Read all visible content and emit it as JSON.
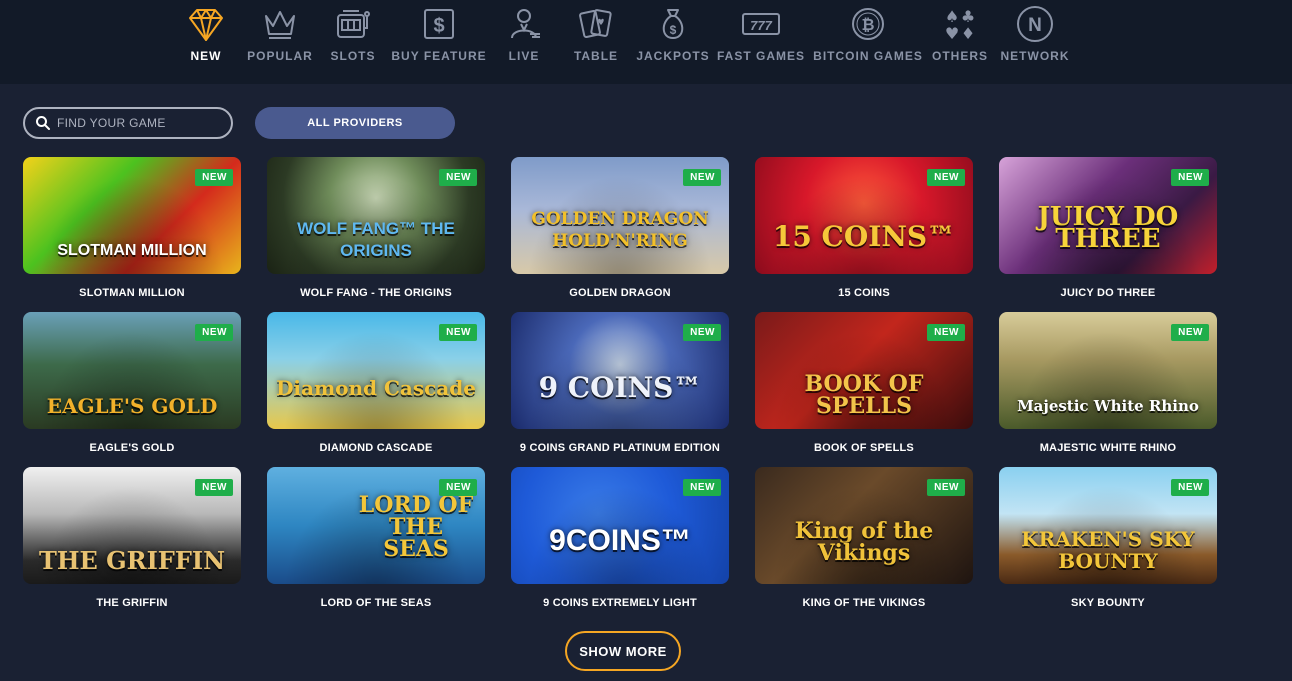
{
  "nav": {
    "items": [
      {
        "label": "NEW",
        "icon": "diamond-icon",
        "active": true
      },
      {
        "label": "POPULAR",
        "icon": "crown-icon",
        "active": false
      },
      {
        "label": "SLOTS",
        "icon": "slot-machine-icon",
        "active": false
      },
      {
        "label": "BUY FEATURE",
        "icon": "dollar-box-icon",
        "active": false
      },
      {
        "label": "LIVE",
        "icon": "live-dealer-icon",
        "active": false
      },
      {
        "label": "TABLE",
        "icon": "cards-icon",
        "active": false
      },
      {
        "label": "JACKPOTS",
        "icon": "money-bag-icon",
        "active": false
      },
      {
        "label": "FAST GAMES",
        "icon": "777-icon",
        "active": false
      },
      {
        "label": "BITCOIN GAMES",
        "icon": "bitcoin-icon",
        "active": false
      },
      {
        "label": "OTHERS",
        "icon": "card-suits-icon",
        "active": false
      },
      {
        "label": "NETWORK",
        "icon": "network-n-icon",
        "active": false
      }
    ]
  },
  "filters": {
    "search_placeholder": "FIND YOUR GAME",
    "search_value": "",
    "providers_label": "ALL PROVIDERS"
  },
  "badge_label": "NEW",
  "games": [
    {
      "title": "SLOTMAN MILLION",
      "logo": "SLOTMAN MILLION",
      "new": true
    },
    {
      "title": "WOLF FANG - THE ORIGINS",
      "logo": "WOLF FANG™ THE ORIGINS",
      "new": true
    },
    {
      "title": "GOLDEN DRAGON",
      "logo": "GOLDEN DRAGON HOLD'N'RING",
      "new": true
    },
    {
      "title": "15 COINS",
      "logo": "15 COINS™",
      "new": true
    },
    {
      "title": "JUICY DO THREE",
      "logo": "JUICY DO THREE",
      "new": true
    },
    {
      "title": "EAGLE'S GOLD",
      "logo": "EAGLE'S GOLD",
      "new": true
    },
    {
      "title": "DIAMOND CASCADE",
      "logo": "Diamond Cascade",
      "new": true
    },
    {
      "title": "9 COINS GRAND PLATINUM EDITION",
      "logo": "9 COINS™",
      "new": true
    },
    {
      "title": "BOOK OF SPELLS",
      "logo": "BOOK OF SPELLS",
      "new": true
    },
    {
      "title": "MAJESTIC WHITE RHINO",
      "logo": "Majestic White Rhino",
      "new": true
    },
    {
      "title": "THE GRIFFIN",
      "logo": "THE GRIFFIN",
      "new": true
    },
    {
      "title": "LORD OF THE SEAS",
      "logo": "LORD OF THE SEAS",
      "new": true
    },
    {
      "title": "9 COINS EXTREMELY LIGHT",
      "logo": "9COINS™",
      "new": true
    },
    {
      "title": "KING OF THE VIKINGS",
      "logo": "King of the Vikings",
      "new": true
    },
    {
      "title": "SKY BOUNTY",
      "logo": "KRAKEN'S SKY BOUNTY",
      "new": true
    }
  ],
  "show_more_label": "SHOW MORE",
  "colors": {
    "background": "#1a2133",
    "nav_background": "#121a28",
    "accent_orange": "#f5a623",
    "badge_green": "#1fae4a",
    "providers_button": "#4a5a8f"
  }
}
